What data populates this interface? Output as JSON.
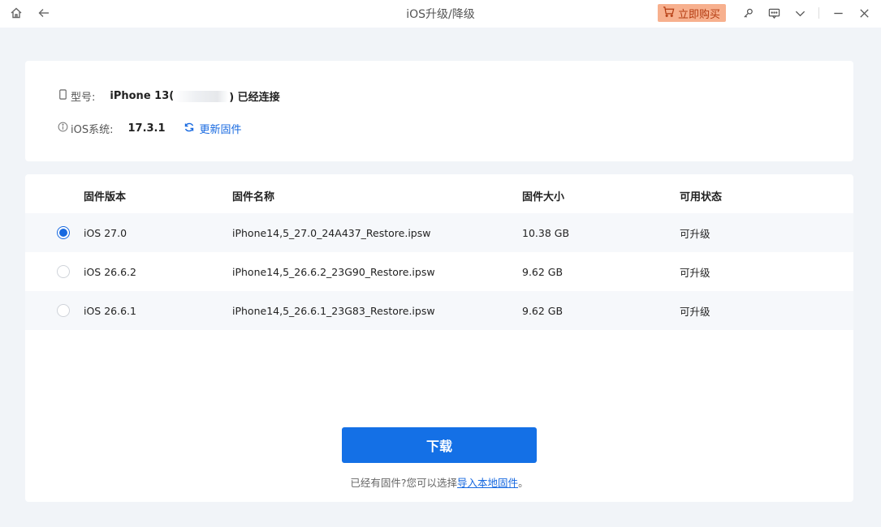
{
  "window": {
    "title": "iOS升级/降级",
    "buy_label": "立即购买"
  },
  "device": {
    "model_label": "型号:",
    "model_value": "iPhone 13(",
    "model_suffix": ") 已经连接",
    "ios_label": "iOS系统:",
    "ios_value": "17.3.1",
    "update_label": "更新固件"
  },
  "table": {
    "headers": [
      "固件版本",
      "固件名称",
      "固件大小",
      "可用状态"
    ],
    "rows": [
      {
        "version": "iOS 27.0",
        "name": "iPhone14,5_27.0_24A437_Restore.ipsw",
        "size": "10.38 GB",
        "status": "可升级",
        "selected": true
      },
      {
        "version": "iOS 26.6.2",
        "name": "iPhone14,5_26.6.2_23G90_Restore.ipsw",
        "size": "9.62 GB",
        "status": "可升级",
        "selected": false
      },
      {
        "version": "iOS 26.6.1",
        "name": "iPhone14,5_26.6.1_23G83_Restore.ipsw",
        "size": "9.62 GB",
        "status": "可升级",
        "selected": false
      }
    ]
  },
  "actions": {
    "download_label": "下载",
    "hint_text": "已经有固件?您可以选择",
    "hint_link": "导入本地固件",
    "hint_end": "。"
  },
  "colors": {
    "accent": "#1470e6",
    "buy_bg": "#f7b08e",
    "page_bg": "#f1f4f8"
  }
}
